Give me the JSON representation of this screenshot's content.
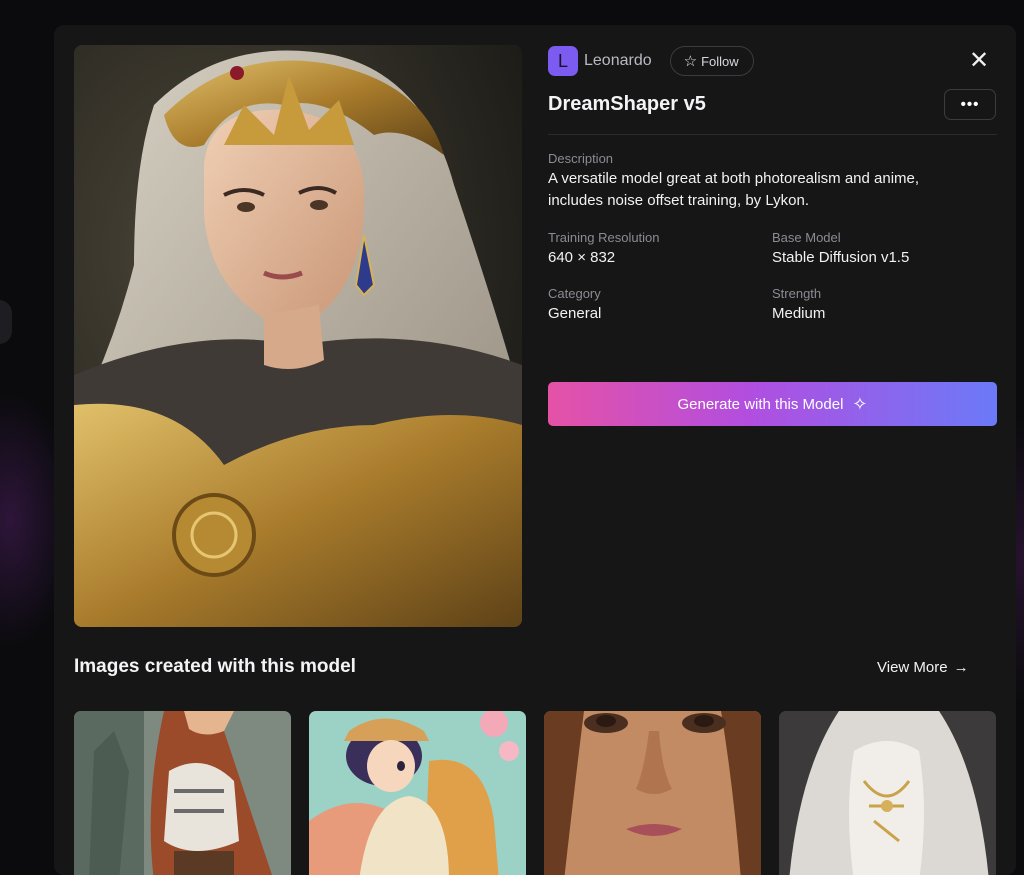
{
  "author": {
    "initial": "L",
    "name": "Leonardo"
  },
  "follow": {
    "label": "Follow",
    "icon": "star-outline-icon"
  },
  "close": {
    "icon": "close-icon"
  },
  "more": {
    "label": "•••",
    "icon": "more-dots-icon"
  },
  "model": {
    "title": "DreamShaper v5",
    "description_label": "Description",
    "description": "A versatile model great at both photorealism and anime, includes noise offset training, by Lykon.",
    "training_resolution_label": "Training Resolution",
    "training_resolution": "640 × 832",
    "base_model_label": "Base Model",
    "base_model": "Stable Diffusion v1.5",
    "category_label": "Category",
    "category": "General",
    "strength_label": "Strength",
    "strength": "Medium"
  },
  "generate": {
    "label": "Generate with this Model",
    "icon": "sparkles-icon"
  },
  "gallery": {
    "title": "Images created with this model",
    "view_more": "View More",
    "view_more_icon": "arrow-right-icon"
  },
  "colors": {
    "accent_gradient_start": "#e552a6",
    "accent_gradient_mid": "#b14ee0",
    "accent_gradient_end": "#6b7af8",
    "modal_bg": "#161616",
    "avatar_bg": "#7c5cf0"
  }
}
